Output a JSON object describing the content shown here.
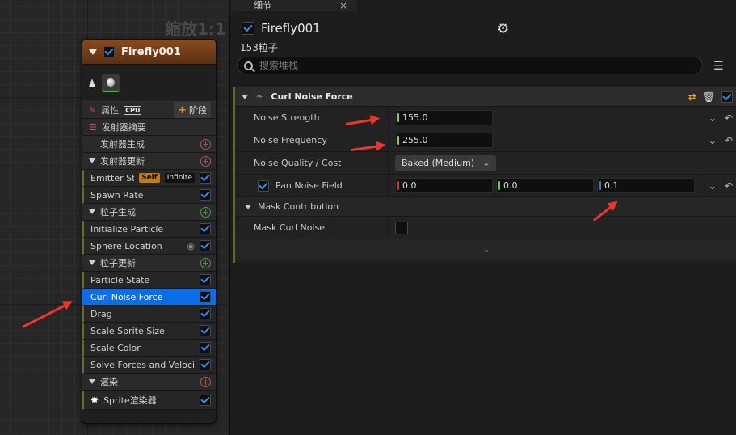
{
  "graph": {
    "zoom_label": "缩放1:1",
    "node": {
      "title": "Firefly001",
      "properties_label": "属性",
      "cpu_label": "CPU",
      "stage_label": "阶段",
      "emitter_summary": "发射器摘要",
      "sections": [
        {
          "label": "发射器生成",
          "type": "header-noarrow"
        },
        {
          "label": "发射器更新",
          "type": "section"
        },
        {
          "label": "Emitter State",
          "type": "item",
          "badges": [
            "Self",
            "Infinite"
          ]
        },
        {
          "label": "Spawn Rate",
          "type": "item"
        },
        {
          "label": "粒子生成",
          "type": "section"
        },
        {
          "label": "Initialize Particle",
          "type": "item"
        },
        {
          "label": "Sphere Location",
          "type": "item"
        },
        {
          "label": "粒子更新",
          "type": "section"
        },
        {
          "label": "Particle State",
          "type": "item"
        },
        {
          "label": "Curl Noise Force",
          "type": "item",
          "selected": true
        },
        {
          "label": "Drag",
          "type": "item"
        },
        {
          "label": "Scale Sprite Size",
          "type": "item"
        },
        {
          "label": "Scale Color",
          "type": "item"
        },
        {
          "label": "Solve Forces and Velocity",
          "type": "item"
        },
        {
          "label": "渲染",
          "type": "section"
        },
        {
          "label": "Sprite渲染器",
          "type": "item"
        }
      ]
    }
  },
  "details": {
    "tab_label": "细节",
    "emitter_name": "Firefly001",
    "particle_count": "153粒子",
    "search_placeholder": "搜索堆栈",
    "category": {
      "title": "Curl Noise Force",
      "noise_strength": {
        "label": "Noise Strength",
        "value": "155.0"
      },
      "noise_frequency": {
        "label": "Noise Frequency",
        "value": "255.0"
      },
      "noise_quality": {
        "label": "Noise Quality / Cost",
        "value": "Baked (Medium)"
      },
      "pan_noise_field": {
        "label": "Pan Noise Field",
        "x": "0.0",
        "y": "0.0",
        "z": "0.1"
      },
      "mask_contribution": {
        "label": "Mask Contribution"
      },
      "mask_curl_noise": {
        "label": "Mask Curl Noise"
      }
    }
  },
  "colors": {
    "accent": "#0b6ee6",
    "annotation_arrow": "#e8372c",
    "node_header": "#8a4a1c"
  }
}
